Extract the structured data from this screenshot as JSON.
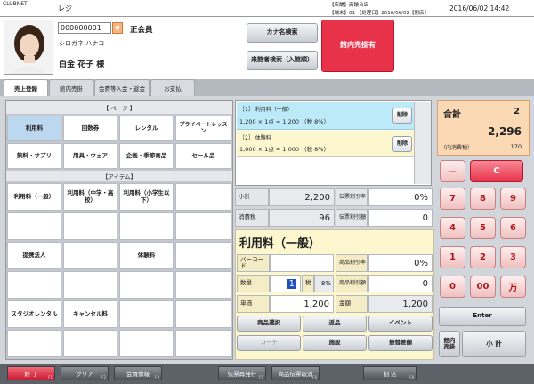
{
  "title_bar": {
    "app": "CLUBNET",
    "screen": "レジ",
    "store_line": "【店舗】高輪台店",
    "terminal_line": "【端末】01 【処理日】2016/06/02【開店】",
    "clock": "2016/06/02 14:42"
  },
  "member": {
    "number": "000000001",
    "rank": "正会員",
    "kana": "シロガネ ハナコ",
    "name": "白金 花子 様"
  },
  "search": {
    "kana_search": "カナ名検索",
    "visitor_search": "来館者検索（入館順）",
    "in_hall_sale": "館内売掛有"
  },
  "tabs": [
    "売上登録",
    "館内売掛",
    "会費等入金・返金",
    "お支払"
  ],
  "page_section": "【 ページ 】",
  "pages": [
    "利用料",
    "回数券",
    "レンタル",
    "プライベートレッスン",
    "飲料・サプリ",
    "用具・ウェア",
    "企画・季節商品",
    "セール品"
  ],
  "item_section": "【アイテム】",
  "items": [
    "利用料（一般）",
    "利用料（中学・高校）",
    "利用料（小学生以下）",
    "",
    "",
    "",
    "",
    "",
    "提携法人",
    "",
    "体験料",
    "",
    "",
    "",
    "",
    "",
    "スタジオレンタル",
    "キャンセル料",
    "",
    "",
    "",
    "",
    "",
    ""
  ],
  "lines": [
    {
      "title": "［1］ 利用料（一般）",
      "detail": "1,200 × 1点 = 1,200 （税 8%）",
      "delete": "削除"
    },
    {
      "title": "［2］ 体験料",
      "detail": "1,000 × 1点 = 1,000 （税 8%）",
      "delete": "削除"
    }
  ],
  "totals": {
    "subtotal_label": "小計",
    "subtotal": "2,200",
    "tax_label": "消費税",
    "tax": "96",
    "slip_rate_label": "伝票割引率",
    "slip_rate": "0%",
    "slip_amount_label": "伝票割引額",
    "slip_amount": "0"
  },
  "current": {
    "name": "利用料（一般）",
    "barcode_label": "バーコード",
    "qty_label": "数量",
    "qty": "1",
    "tax_rate_label": "税",
    "tax_rate": "8%",
    "price_label": "単価",
    "price": "1,200",
    "item_rate_label": "商品割引率",
    "item_rate": "0%",
    "item_amount_label": "商品割引額",
    "item_amount": "0",
    "amount_label": "金額",
    "amount": "1,200"
  },
  "actions": [
    "商品選択",
    "返品",
    "イベント",
    "コーチ",
    "施設",
    "振替差額"
  ],
  "summary": {
    "total_label": "合計",
    "count": "2",
    "total": "2,296",
    "tax_label": "（内消費税）",
    "tax": "170"
  },
  "keypad": {
    "minus": "－",
    "clear": "C",
    "keys": [
      "7",
      "8",
      "9",
      "4",
      "5",
      "6",
      "1",
      "2",
      "3",
      "0",
      "00",
      "万"
    ],
    "enter": "Enter",
    "hall_sale": "館内売掛",
    "subtotal": "小 計"
  },
  "fkeys": [
    {
      "label": "終 了",
      "fn": "F1"
    },
    {
      "label": "クリア",
      "fn": "F2"
    },
    {
      "label": "会員情報",
      "fn": "F3"
    },
    {
      "label": "伝票再発行",
      "fn": "F5"
    },
    {
      "label": "商品伝票取消",
      "fn": "F6"
    },
    {
      "label": "割 込",
      "fn": "F8"
    }
  ],
  "colors": {
    "accent_red": "#e8324a",
    "selected_line": "#bdeaf8",
    "line2": "#fdf7d0",
    "total_panel": "#fbd9b4"
  }
}
